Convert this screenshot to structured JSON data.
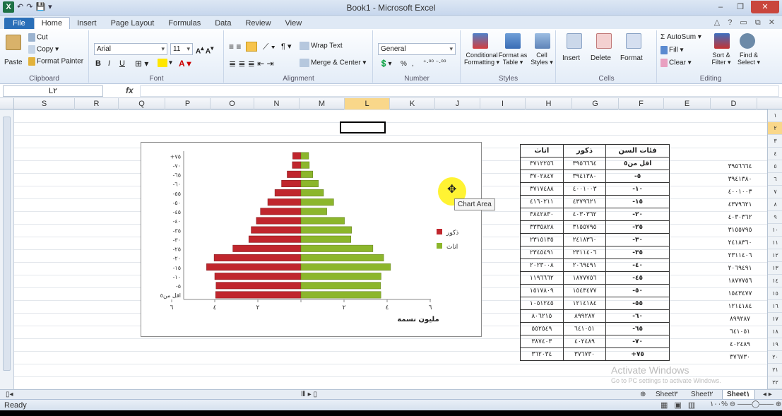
{
  "window": {
    "title": "Book1 - Microsoft Excel",
    "minimize": "–",
    "restore": "❐",
    "close": "✕"
  },
  "qat": [
    "↶",
    "↷",
    "💾",
    "▾"
  ],
  "tabs": [
    "File",
    "Home",
    "Insert",
    "Page Layout",
    "Formulas",
    "Data",
    "Review",
    "View"
  ],
  "tabs_right": "△ ? ▭ ⧉ ✕",
  "ribbon": {
    "clipboard": {
      "label": "Clipboard",
      "paste": "Paste",
      "cut": "Cut",
      "copy": "Copy ▾",
      "format_painter": "Format Painter"
    },
    "font": {
      "label": "Font",
      "name": "Arial",
      "size": "11",
      "bold": "B",
      "italic": "I",
      "underline": "U"
    },
    "alignment": {
      "label": "Alignment",
      "wrap": "Wrap Text",
      "merge": "Merge & Center ▾"
    },
    "number": {
      "label": "Number",
      "format": "General",
      "percent": "%",
      "comma": ","
    },
    "styles": {
      "label": "Styles",
      "conditional": "Conditional Formatting ▾",
      "format_table": "Format as Table ▾",
      "cell_styles": "Cell Styles ▾"
    },
    "cells": {
      "label": "Cells",
      "insert": "Insert",
      "delete": "Delete",
      "format": "Format"
    },
    "editing": {
      "label": "Editing",
      "autosum": "Σ AutoSum ▾",
      "fill": "Fill ▾",
      "clear": "Clear ▾",
      "sort": "Sort & Filter ▾",
      "find": "Find & Select ▾"
    }
  },
  "formula_bar": {
    "name_box": "L٢",
    "fx": "fx",
    "value": ""
  },
  "columns": [
    "S",
    "R",
    "Q",
    "P",
    "O",
    "N",
    "M",
    "L",
    "K",
    "J",
    "I",
    "H",
    "G",
    "F",
    "E",
    "D"
  ],
  "selected_column": "L",
  "rows": [
    "١",
    "٢",
    "٣",
    "٤",
    "٥",
    "٦",
    "٧",
    "٨",
    "٩",
    "١٠",
    "١١",
    "١٢",
    "١٣",
    "١٤",
    "١٥",
    "١٦",
    "١٧",
    "١٨",
    "١٩",
    "٢٠",
    "٢١",
    "٢٢"
  ],
  "selected_row": "٢",
  "table": {
    "headers": [
      "اناث",
      "ذكور",
      "فئات السن"
    ],
    "rows": [
      [
        "٣٧١٢٢٥٦",
        "٣٩٥٦٦٦٤",
        "اقل من٥"
      ],
      [
        "٣٧٠٢٨٤٧",
        "٣٩٤١٣٨٠",
        "-٥"
      ],
      [
        "٣٧١٧٤٨٨",
        "٤٠٠١٠٠٣",
        "-١٠"
      ],
      [
        "٤١٦٠٢١١",
        "٤٣٧٩٦٢١",
        "-١٥"
      ],
      [
        "٣٨٤٢٨٣٠",
        "٤٠٣٠٣٦٢",
        "-٢٠"
      ],
      [
        "٣٣٣٥٨٢٨",
        "٣١٥٥٧٩٥",
        "-٢٥"
      ],
      [
        "٢٣١٥١٣٥",
        "٢٤١٨٣٦٠",
        "-٣٠"
      ],
      [
        "٢٣٤٥٤٩١",
        "٢٣١١٤٠٦",
        "-٣٥"
      ],
      [
        "٢٠٢٣٠٠٨",
        "٢٠٦٩٤٩١",
        "-٤٠"
      ],
      [
        "١١٩٦٦٦٢",
        "١٨٧٧٧٥٦",
        "-٤٥"
      ],
      [
        "١٥١٧٨٠٩",
        "١٥٤٣٤٧٧",
        "-٥٠"
      ],
      [
        "١٠٥١٢٤٥",
        "١٢١٤١٨٤",
        "-٥٥"
      ],
      [
        "٨٠٦٢١٥",
        "٨٩٩٢٨٧",
        "-٦٠"
      ],
      [
        "٥٥٢٥٤٩",
        "٦٤١٠٥١",
        "-٦٥"
      ],
      [
        "٣٨٧٤٠٣",
        "٤٠٢٤٨٩",
        "-٧٠"
      ],
      [
        "٣٦٢٠٣٤",
        "٣٧٦٧٣٠",
        "+٧٥"
      ]
    ]
  },
  "column_d": [
    "٣٩٥٦٦٦٤",
    "٣٩٤١٣٨٠",
    "٤٠٠١٠٠٣",
    "٤٣٧٩٦٢١",
    "٤٠٣٠٣٦٢",
    "٣١٥٥٧٩٥",
    "٢٤١٨٣٦٠",
    "٢٣١١٤٠٦",
    "٢٠٦٩٤٩١",
    "١٨٧٧٧٥٦",
    "١٥٤٣٤٧٧",
    "١٢١٤١٨٤",
    "٨٩٩٢٨٧",
    "٦٤١٠٥١",
    "٤٠٢٤٨٩",
    "٣٧٦٧٣٠"
  ],
  "chart_data": {
    "type": "bar",
    "categories": [
      "اقل من٥",
      "-٥",
      "-١٠",
      "-١٥",
      "-٢٠",
      "-٢٥",
      "-٣٠",
      "-٣٥",
      "-٤٠",
      "-٤٥",
      "-٥٠",
      "-٥٥",
      "-٦٠",
      "-٦٥",
      "-٧٠",
      "+٧٥"
    ],
    "series": [
      {
        "name": "ذكور",
        "color": "#c0262d",
        "values": [
          3.96,
          3.94,
          4.0,
          4.38,
          4.03,
          3.16,
          2.42,
          2.31,
          2.07,
          1.88,
          1.54,
          1.21,
          0.9,
          0.64,
          0.4,
          0.38
        ]
      },
      {
        "name": "اناث",
        "color": "#8cb62c",
        "values": [
          3.71,
          3.7,
          3.72,
          4.16,
          3.84,
          3.34,
          2.32,
          2.35,
          2.02,
          1.2,
          1.52,
          1.05,
          0.81,
          0.55,
          0.39,
          0.36
        ]
      }
    ],
    "xlabel": "مليون نسمة",
    "x_ticks": [
      "٦",
      "٤",
      "٢",
      "",
      "٢",
      "٤",
      "٦"
    ],
    "xlim": [
      -6,
      6
    ],
    "legend": "right",
    "tooltip": "Chart Area"
  },
  "watermark": {
    "line1": "Activate Windows",
    "line2": "Go to PC settings to activate Windows."
  },
  "sheets": [
    "Sheet٣",
    "Sheet٢",
    "Sheet١"
  ],
  "active_sheet": "Sheet١",
  "status": {
    "ready": "Ready",
    "views": "▦ ▣ ▥",
    "zoom": "١٠٠% ⊖ ——◯—— ⊕"
  }
}
